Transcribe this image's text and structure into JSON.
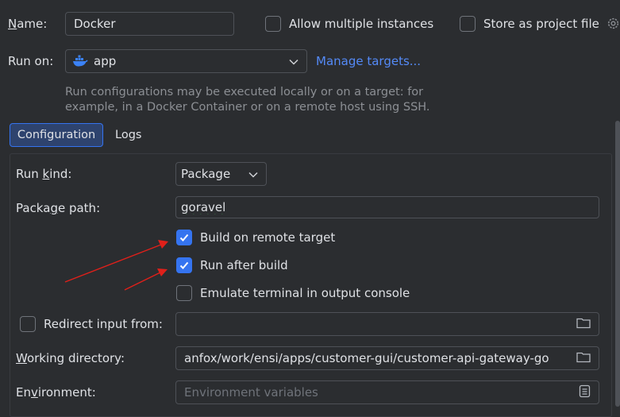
{
  "header": {
    "name_label": "Name:",
    "name_value": "Docker",
    "allow_multiple_label": "Allow multiple instances",
    "allow_multiple_checked": false,
    "store_project_label": "Store as project file",
    "store_project_checked": false
  },
  "run_on": {
    "label": "Run on:",
    "value": "app",
    "manage_targets": "Manage targets...",
    "hint_line1": "Run configurations may be executed locally or on a target: for",
    "hint_line2": "example, in a Docker Container or on a remote host using SSH."
  },
  "tabs": [
    {
      "label": "Configuration",
      "active": true
    },
    {
      "label": "Logs",
      "active": false
    }
  ],
  "config": {
    "run_kind_label": "Run kind:",
    "run_kind_value": "Package",
    "package_path_label": "Package path:",
    "package_path_value": "goravel",
    "build_remote_label": "Build on remote target",
    "build_remote_checked": true,
    "run_after_build_label": "Run after build",
    "run_after_build_checked": true,
    "emulate_terminal_label": "Emulate terminal in output console",
    "emulate_terminal_checked": false,
    "redirect_input_label": "Redirect input from:",
    "redirect_input_checked": false,
    "redirect_input_value": "",
    "working_dir_label": "Working directory:",
    "working_dir_value": "anfox/work/ensi/apps/customer-gui/customer-api-gateway-go",
    "environment_label": "Environment:",
    "environment_placeholder": "Environment variables"
  },
  "colors": {
    "background": "#2b2d30",
    "accent": "#3574f0",
    "link": "#548af7",
    "arrow": "#e0201a"
  }
}
